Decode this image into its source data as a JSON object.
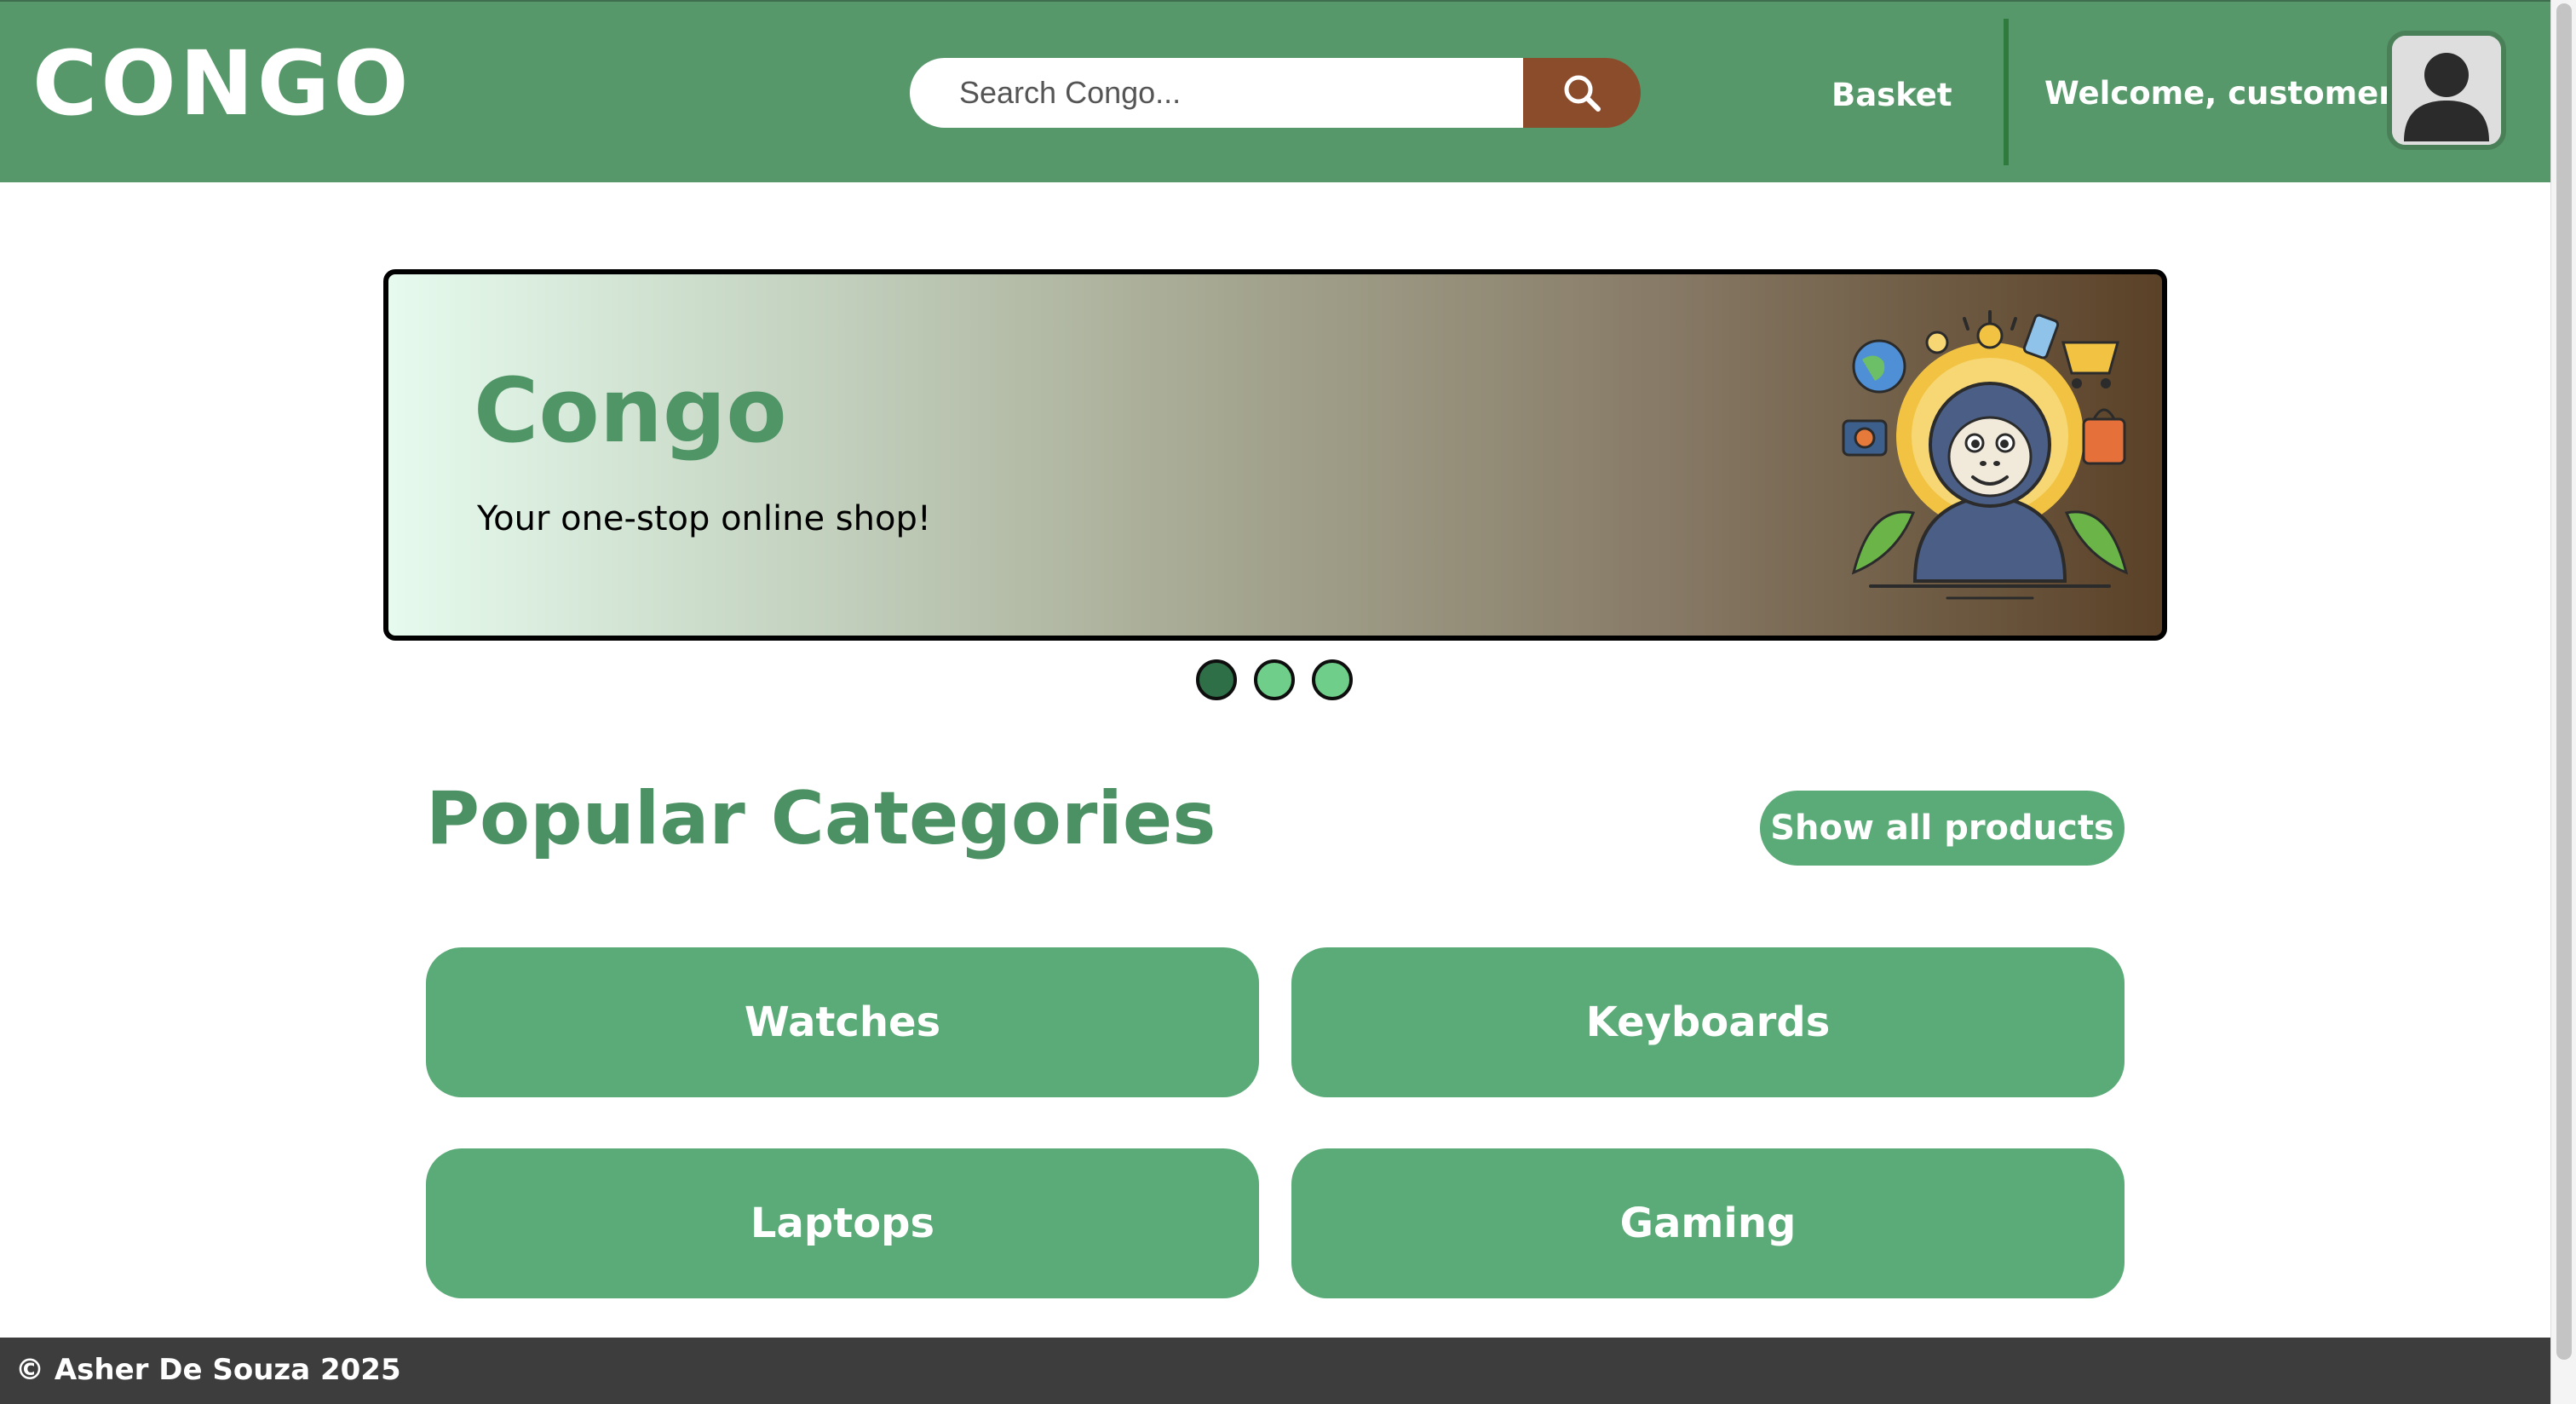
{
  "header": {
    "logo": "CONGO",
    "search": {
      "placeholder": "Search Congo...",
      "value": "",
      "button_icon": "search-icon"
    },
    "basket_label": "Basket",
    "welcome_text": "Welcome, customer!",
    "avatar_icon": "user-avatar-icon"
  },
  "hero": {
    "title": "Congo",
    "subtitle": "Your one-stop online shop!",
    "illustration_icon": "gorilla-shopping-illustration",
    "slides": 3,
    "active_slide": 1
  },
  "categories": {
    "title": "Popular Categories",
    "show_all_label": "Show all products",
    "items": [
      {
        "label": "Watches"
      },
      {
        "label": "Keyboards"
      },
      {
        "label": "Laptops"
      },
      {
        "label": "Gaming"
      }
    ]
  },
  "footer": {
    "text": "© Asher De Souza 2025"
  },
  "colors": {
    "brand_green": "#57986b",
    "tile_green": "#5aab78",
    "heading_green": "#4c9163",
    "search_button_brown": "#8b4c2c",
    "footer_dark": "#3d3d3d",
    "dot_active": "#2e6f48",
    "dot_inactive": "#6ece8a"
  }
}
